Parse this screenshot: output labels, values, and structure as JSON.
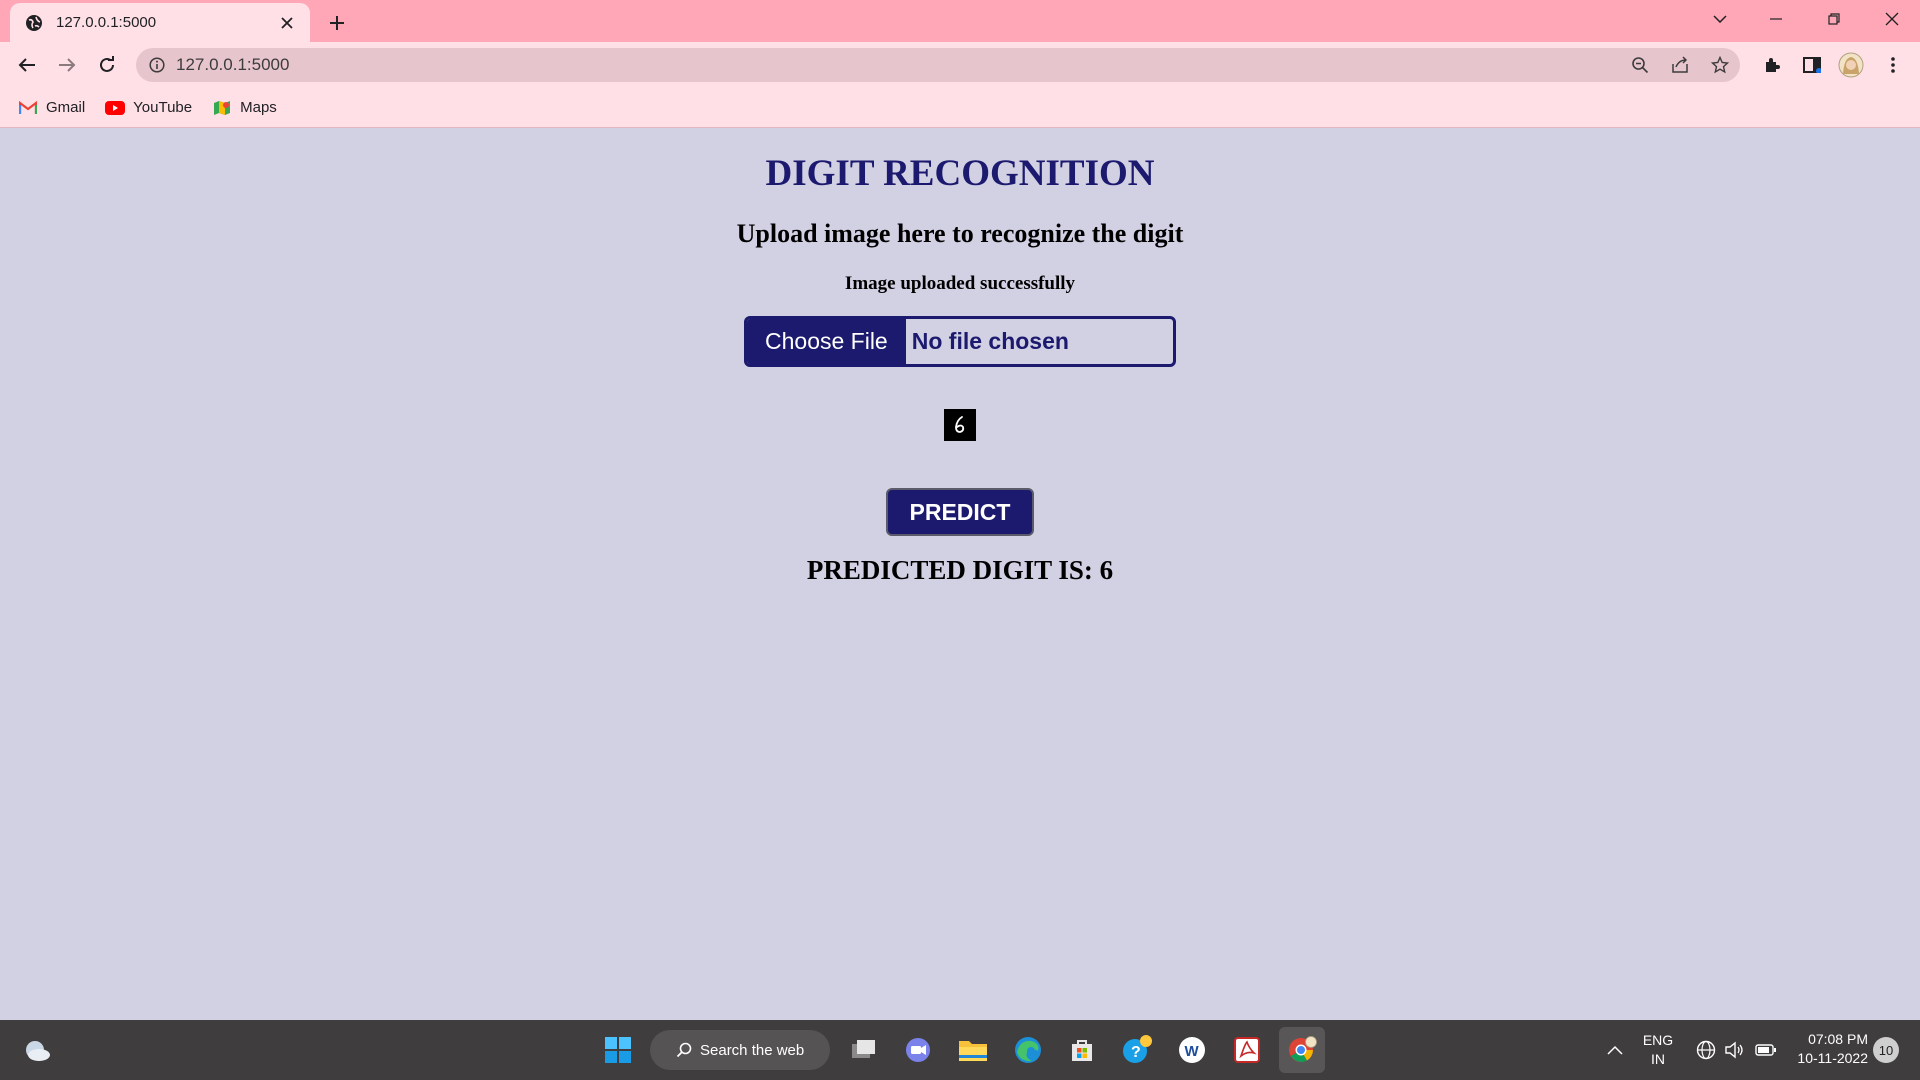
{
  "browser": {
    "tab_title": "127.0.0.1:5000",
    "url": "127.0.0.1:5000",
    "bookmarks": [
      {
        "label": "Gmail",
        "icon": "gmail-icon"
      },
      {
        "label": "YouTube",
        "icon": "youtube-icon"
      },
      {
        "label": "Maps",
        "icon": "maps-icon"
      }
    ]
  },
  "page": {
    "title": "DIGIT RECOGNITION",
    "subtitle": "Upload image here to recognize the digit",
    "status": "Image uploaded successfully",
    "file_button_label": "Choose File",
    "file_name_text": "No file chosen",
    "preview_digit": "6",
    "predict_label": "PREDICT",
    "result_text": "PREDICTED DIGIT IS: 6"
  },
  "taskbar": {
    "search_label": "Search the web",
    "language_top": "ENG",
    "language_bottom": "IN",
    "time": "07:08 PM",
    "date": "10-11-2022",
    "notification_count": "10"
  },
  "colors": {
    "tab_strip": "#ffa7b6",
    "toolbar": "#ffe0e6",
    "page_background": "#d2d0e3",
    "accent_navy": "#1c1a6e",
    "taskbar": "#3f3d3d"
  }
}
